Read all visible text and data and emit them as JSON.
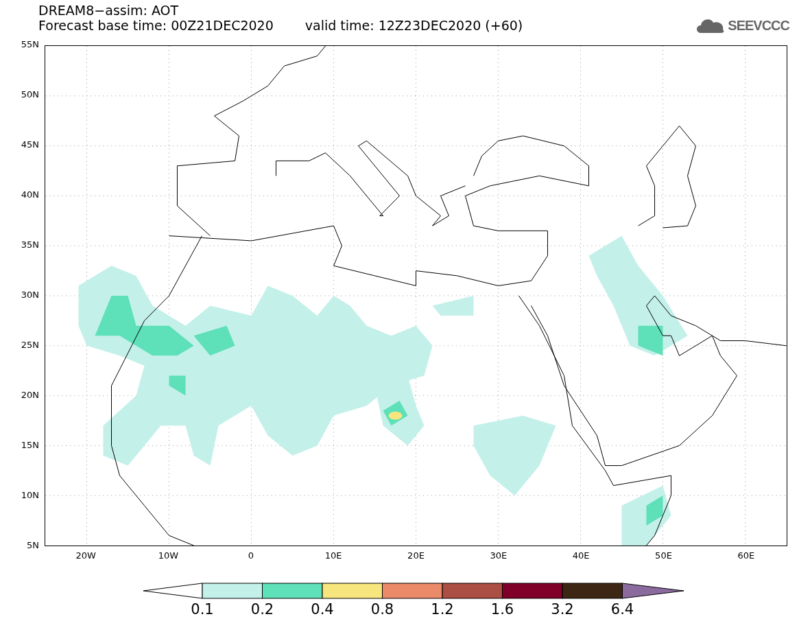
{
  "header": {
    "title": "DREAM8−assim: AOT",
    "base_time": "Forecast base time: 00Z21DEC2020",
    "valid_time": "valid time: 12Z23DEC2020 (+60)",
    "logo": "SEEVCCC"
  },
  "map": {
    "yticks": [
      "55N",
      "50N",
      "45N",
      "40N",
      "35N",
      "30N",
      "25N",
      "20N",
      "15N",
      "10N",
      "5N"
    ],
    "xticks": [
      "20W",
      "10W",
      "0",
      "10E",
      "20E",
      "30E",
      "40E",
      "50E",
      "60E"
    ]
  },
  "legend": {
    "bins": [
      {
        "kind": "under",
        "color": "#ffffff"
      },
      {
        "kind": "box",
        "color": "#c4f0ea"
      },
      {
        "kind": "box",
        "color": "#5ee0b8"
      },
      {
        "kind": "box",
        "color": "#f7e67e"
      },
      {
        "kind": "box",
        "color": "#ea8a68"
      },
      {
        "kind": "box",
        "color": "#ab4e43"
      },
      {
        "kind": "box",
        "color": "#80002a"
      },
      {
        "kind": "box",
        "color": "#3d2614"
      },
      {
        "kind": "over",
        "color": "#8b6a9e"
      }
    ],
    "labels": [
      "0.1",
      "0.2",
      "0.4",
      "0.8",
      "1.2",
      "1.6",
      "3.2",
      "6.4"
    ]
  }
}
